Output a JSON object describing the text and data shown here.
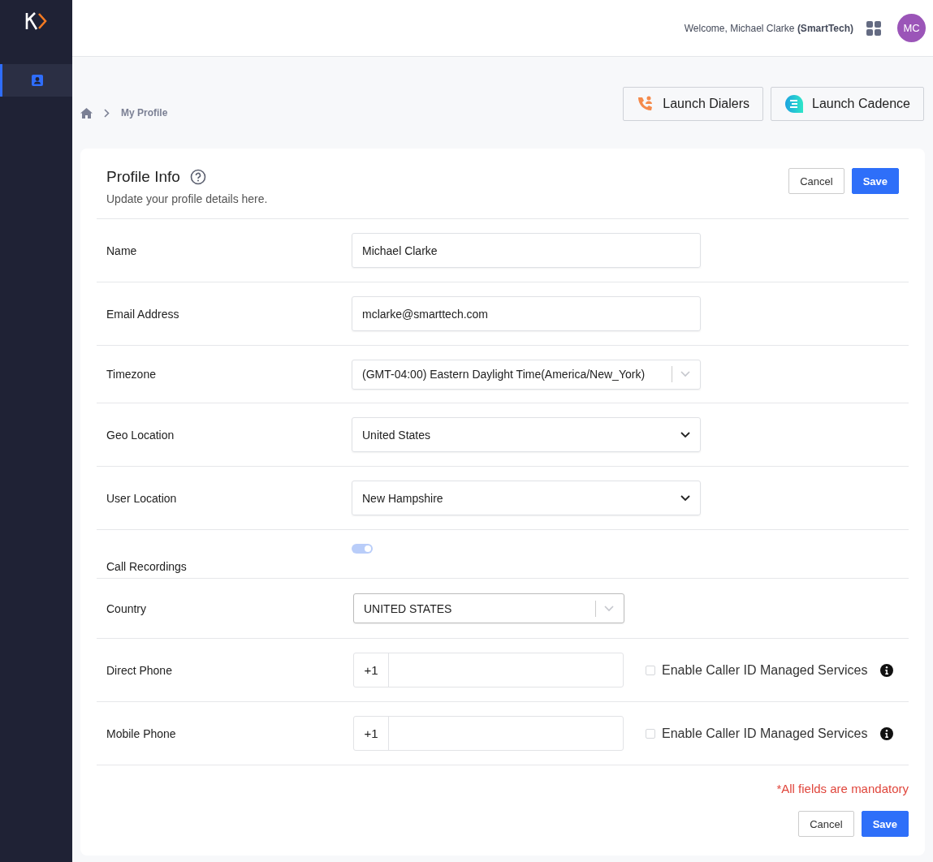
{
  "header": {
    "welcome": "Welcome, Michael Clarke",
    "company": "(SmartTech)",
    "avatar": "MC"
  },
  "sidebar": {
    "items": [
      {
        "selected": true
      }
    ]
  },
  "breadcrumb": {
    "current": "My Profile"
  },
  "launch_buttons": [
    {
      "kind": "dialer",
      "label": "Launch Dialers"
    },
    {
      "kind": "cadence",
      "label": "Launch Cadence"
    }
  ],
  "card": {
    "title": "Profile Info",
    "subtitle": "Update your profile details here.",
    "cancel": "Cancel",
    "save": "Save"
  },
  "fields": [
    {
      "kind": "text",
      "label": "Name",
      "value": "Michael Clarke"
    },
    {
      "kind": "text",
      "label": "Email Address",
      "value": "mclarke@smarttech.com"
    },
    {
      "kind": "combo",
      "label": "Timezone",
      "value": "(GMT-04:00) Eastern Daylight Time(America/New_York)"
    },
    {
      "kind": "select",
      "label": "Geo Location",
      "value": "United States"
    },
    {
      "kind": "select",
      "label": "User Location",
      "value": "New Hampshire"
    },
    {
      "kind": "toggle",
      "label": "Call Recordings",
      "on": true
    },
    {
      "kind": "combo-short",
      "label": "Country",
      "value": "UNITED STATES"
    },
    {
      "kind": "phone",
      "label": "Direct Phone",
      "prefix": "+1",
      "option": "Enable Caller ID Managed Services",
      "checked": false
    },
    {
      "kind": "phone",
      "label": "Mobile Phone",
      "prefix": "+1",
      "option": "Enable Caller ID Managed Services",
      "checked": false
    }
  ],
  "footer": {
    "note": "*All fields are mandatory",
    "cancel": "Cancel",
    "save": "Save"
  }
}
